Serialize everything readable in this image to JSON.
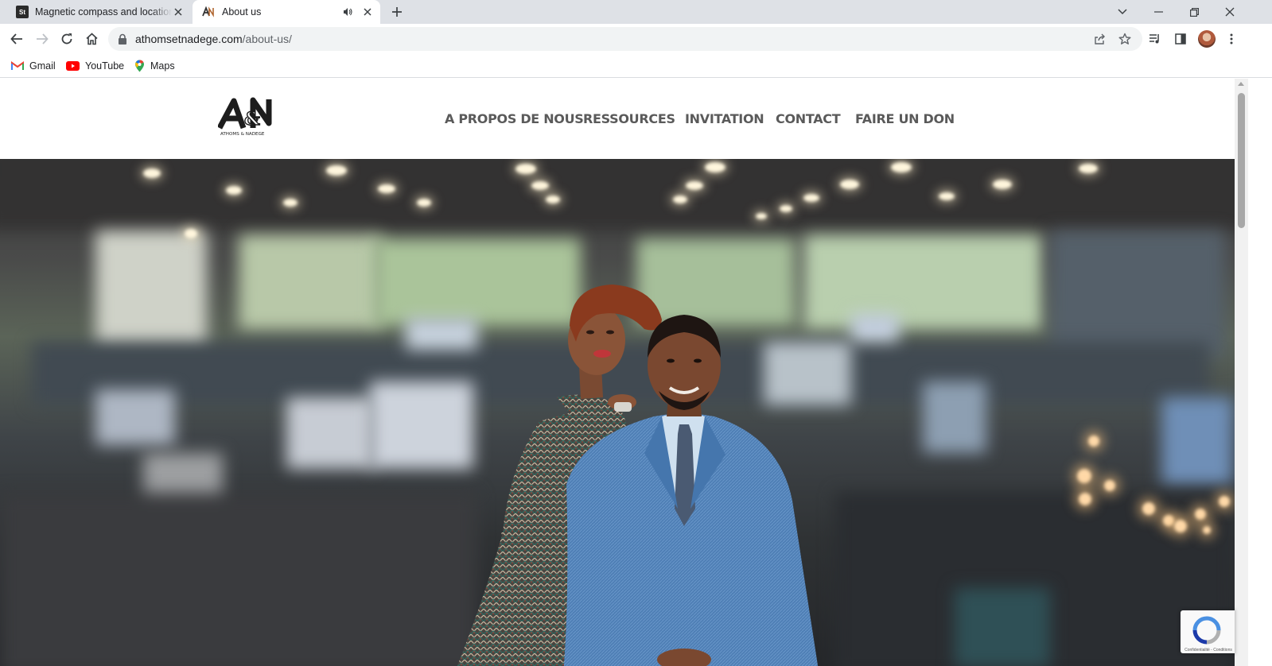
{
  "browser": {
    "tabs": [
      {
        "title": "Magnetic compass and location",
        "favicon": "St",
        "active": false
      },
      {
        "title": "About us",
        "favicon": "A&N",
        "active": true,
        "audio": true
      }
    ],
    "url_host": "athomsetnadege.com",
    "url_path": "/about-us/",
    "bookmarks": [
      {
        "label": "Gmail",
        "icon": "gmail-icon"
      },
      {
        "label": "YouTube",
        "icon": "youtube-icon"
      },
      {
        "label": "Maps",
        "icon": "maps-icon"
      }
    ]
  },
  "site": {
    "logo_text": "A&N",
    "logo_subtext": "ATHOMS & NADEGE",
    "nav": [
      {
        "label": "A PROPOS DE NOUS"
      },
      {
        "label": "RESSOURCES"
      },
      {
        "label": "INVITATION"
      },
      {
        "label": "CONTACT"
      },
      {
        "label": "FAIRE UN DON"
      }
    ]
  },
  "recaptcha": {
    "text": "Confidentialité - Conditions"
  },
  "colors": {
    "tabstrip": "#dee1e6",
    "nav_text": "#5a5a5a",
    "suit_blue": "#4f7fb5"
  }
}
